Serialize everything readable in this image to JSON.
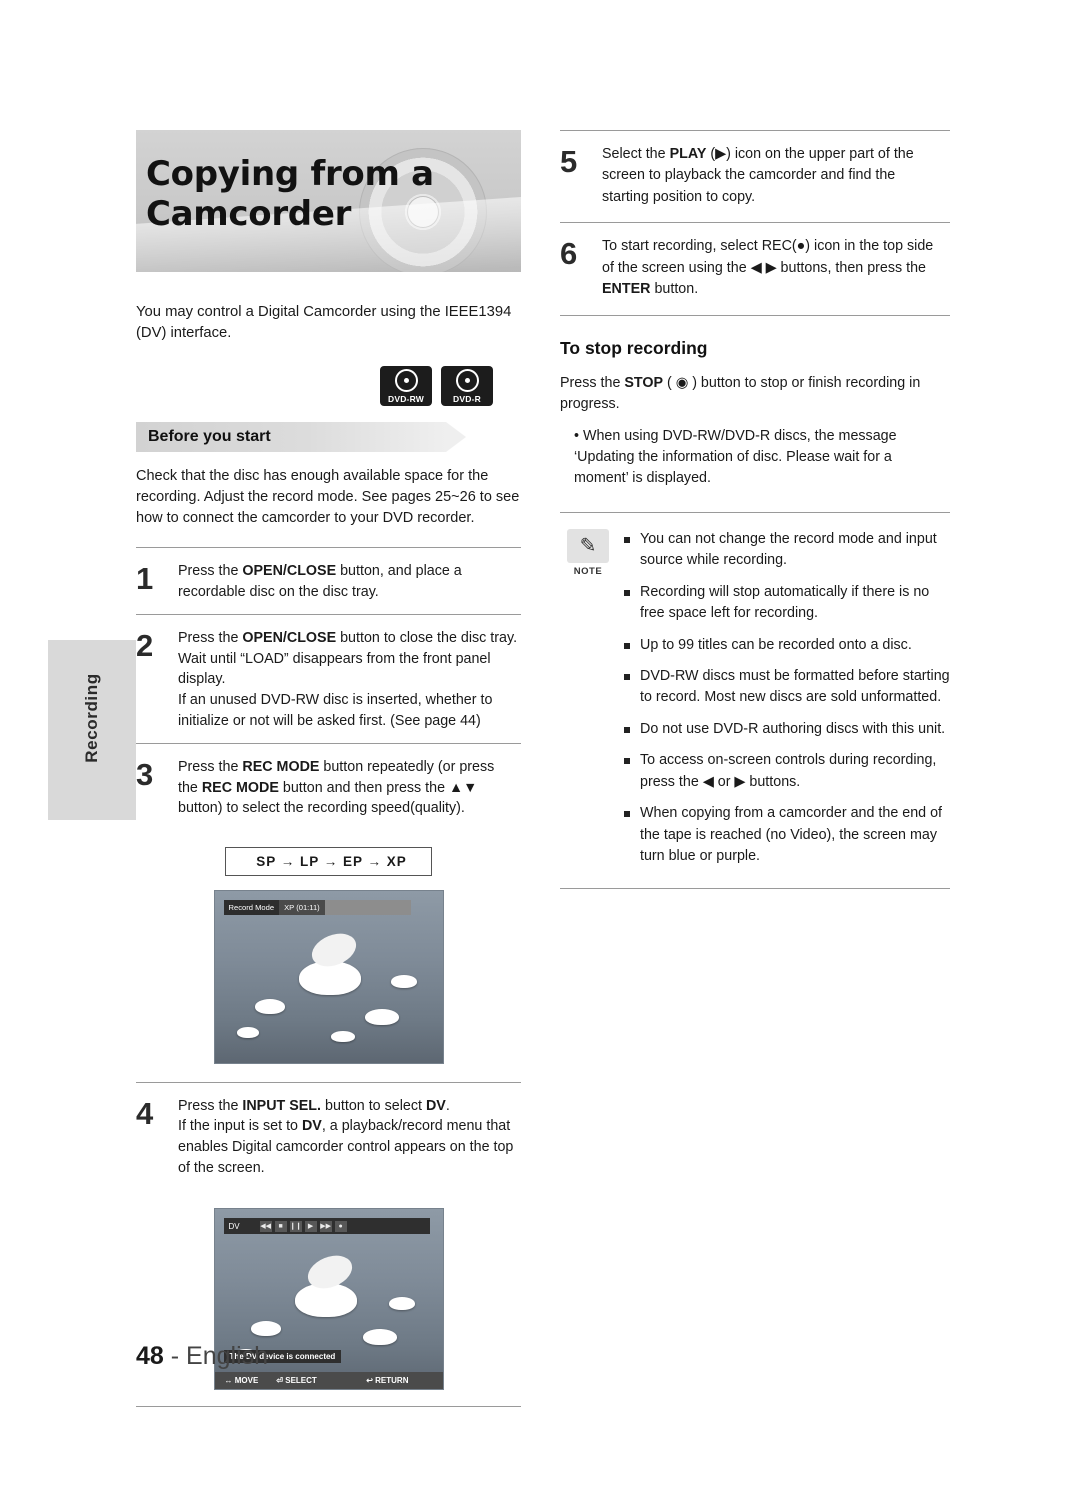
{
  "page": {
    "number": "48",
    "language": "English",
    "side_tab_label": "Recording"
  },
  "title": "Copying from a Camcorder",
  "intro": "You may control a Digital  Camcorder using the IEEE1394 (DV) interface.",
  "disc_badges": [
    {
      "label": "DVD-RW"
    },
    {
      "label": "DVD-R"
    }
  ],
  "before_you_start": {
    "heading": "Before you start",
    "body": "Check that the disc has enough available space for the recording. Adjust the record mode. See pages 25~26 to see how to connect the camcorder to your DVD recorder."
  },
  "steps": [
    {
      "number": "1",
      "lines": [
        "Press the OPEN/CLOSE button, and place a",
        "recordable disc on the disc tray."
      ]
    },
    {
      "number": "2",
      "lines": [
        "Press the OPEN/CLOSE button to close the disc tray.",
        "Wait until “LOAD” disappears from the front panel display.",
        "If an unused DVD-RW disc is inserted, whether to",
        "initialize or not will be asked first. (See page 44)"
      ]
    },
    {
      "number": "3",
      "lines": [
        "Press the REC MODE button repeatedly (or press",
        "the REC MODE button and then press the ▲▼",
        "button) to select the recording speed(quality)."
      ]
    },
    {
      "number": "4",
      "lines": [
        "Press the INPUT SEL. button to select DV.",
        "If the input is set to DV, a playback/record menu that",
        "enables Digital camcorder  control appears on the top",
        "of the screen."
      ]
    }
  ],
  "rec_mode_chain": "SP → LP → EP → XP",
  "screenshot_recmode": {
    "label": "Record Mode",
    "value": "XP (01:11)"
  },
  "screenshot_dv": {
    "title": "DV",
    "caption": "The DV device is connected",
    "footer_move": "MOVE",
    "footer_select": "SELECT",
    "footer_return": "RETURN"
  },
  "right_steps": [
    {
      "number": "5",
      "lines": [
        "Select the PLAY (▶) icon on the upper part of the",
        "screen to playback the camcorder and find the",
        "starting position to copy."
      ]
    },
    {
      "number": "6",
      "lines": [
        "To start recording, select REC(●) icon in the top side",
        "of the screen using the ◀ ▶ buttons, then press the",
        "ENTER button."
      ]
    }
  ],
  "stop_recording": {
    "heading": "To stop recording",
    "body": "Press the STOP ( ◉ )  button to stop or finish recording in progress.",
    "bullet": "• When using DVD-RW/DVD-R discs, the message ‘Updating the information of disc. Please wait for a moment’ is displayed."
  },
  "note": {
    "caption": "NOTE",
    "items": [
      "You can not change the record mode and input source while recording.",
      "Recording will stop automatically if there is no free space left for recording.",
      "Up to 99 titles can be recorded onto a disc.",
      "DVD-RW discs must be formatted before starting to record. Most new discs are sold unformatted.",
      "Do not use DVD-R authoring discs with this unit.",
      "To access on-screen controls during recording, press the ◀ or ▶ buttons.",
      "When copying from a camcorder and the end of the tape is reached (no Video), the screen may turn blue or purple."
    ]
  }
}
